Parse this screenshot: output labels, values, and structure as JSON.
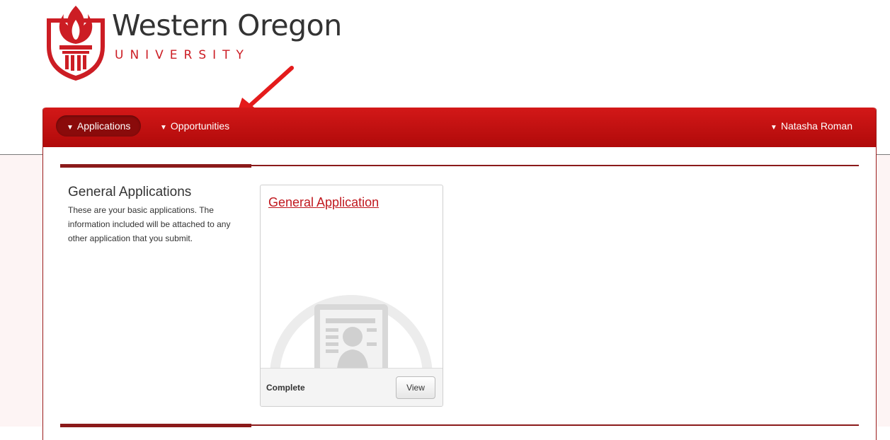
{
  "logo": {
    "title": "Western Oregon",
    "subtitle": "UNIVERSITY"
  },
  "nav": {
    "items": [
      {
        "label": "Applications",
        "caret": "▼",
        "active": true
      },
      {
        "label": "Opportunities",
        "caret": "▼",
        "active": false
      }
    ],
    "user": {
      "label": "Natasha Roman",
      "caret": "▼"
    }
  },
  "section": {
    "title": "General Applications",
    "description": "These are your basic applications. The information included will be attached to any other application that you submit."
  },
  "card": {
    "title": "General Application",
    "status": "Complete",
    "button_label": "View",
    "icon": "applicant-profile-icon"
  },
  "colors": {
    "brand_red": "#cc1d24",
    "nav_red": "#c41212",
    "active_pill": "#8a0b0b",
    "link_red": "#c0181e"
  }
}
